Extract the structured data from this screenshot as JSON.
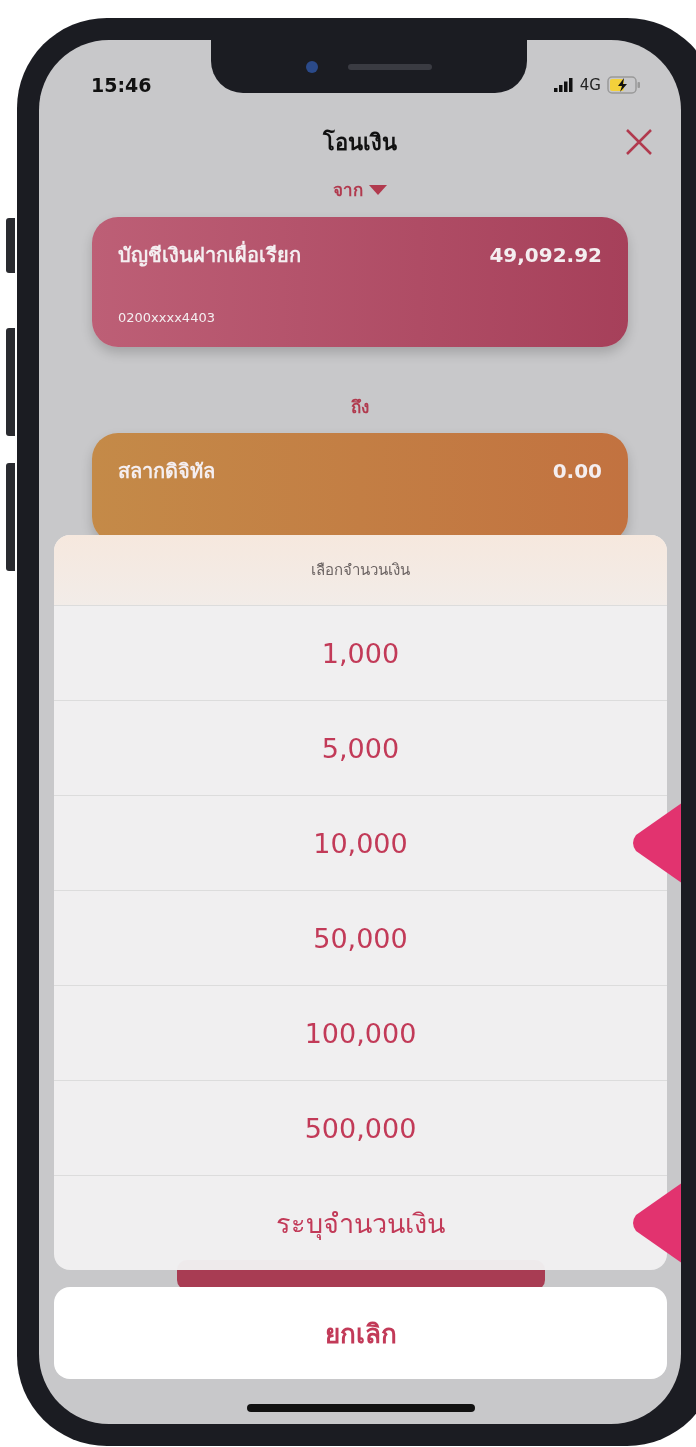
{
  "status_bar": {
    "time": "15:46",
    "network": "4G"
  },
  "header": {
    "title": "โอนเงิน"
  },
  "from": {
    "label": "จาก",
    "account": {
      "name": "บัญชีเงินฝากเผื่อเรียก",
      "balance": "49,092.92",
      "number": "0200xxxx4403"
    }
  },
  "to": {
    "label": "ถึง",
    "account": {
      "name": "สลากดิจิทัล",
      "balance": "0.00"
    }
  },
  "amount_sheet": {
    "title": "เลือกจำนวนเงิน",
    "options": [
      {
        "label": "1,000",
        "highlighted": false
      },
      {
        "label": "5,000",
        "highlighted": false
      },
      {
        "label": "10,000",
        "highlighted": true
      },
      {
        "label": "50,000",
        "highlighted": false
      },
      {
        "label": "100,000",
        "highlighted": false
      },
      {
        "label": "500,000",
        "highlighted": false
      },
      {
        "label": "ระบุจำนวนเงิน",
        "highlighted": true
      }
    ],
    "cancel": "ยกเลิก"
  }
}
